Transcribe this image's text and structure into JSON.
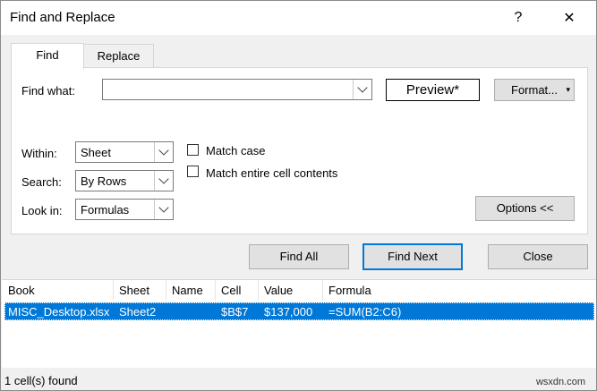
{
  "window": {
    "title": "Find and Replace",
    "help_glyph": "?",
    "close_glyph": "✕",
    "icons": [
      "help-icon",
      "close-icon"
    ]
  },
  "tabs": [
    {
      "label": "Find",
      "selected": true
    },
    {
      "label": "Replace",
      "selected": false
    }
  ],
  "find": {
    "label": "Find what:",
    "value": "",
    "preview": "Preview*",
    "format_label": "Format...",
    "format_arrow": "▾"
  },
  "options": {
    "within": {
      "label": "Within:",
      "value": "Sheet"
    },
    "search": {
      "label": "Search:",
      "value": "By Rows"
    },
    "look_in": {
      "label": "Look in:",
      "value": "Formulas"
    },
    "match_case": {
      "label": "Match case",
      "checked": false
    },
    "match_entire": {
      "label": "Match entire cell contents",
      "checked": false
    },
    "options_button": "Options <<"
  },
  "actions": {
    "find_all": "Find All",
    "find_next": "Find Next",
    "close": "Close"
  },
  "results": {
    "columns": [
      "Book",
      "Sheet",
      "Name",
      "Cell",
      "Value",
      "Formula"
    ],
    "rows": [
      {
        "book": "MISC_Desktop.xlsx",
        "sheet": "Sheet2",
        "name": "",
        "cell": "$B$7",
        "value": "$137,000",
        "formula": "=SUM(B2:C6)"
      }
    ],
    "status": "1 cell(s) found"
  },
  "watermark": "wsxdn.com",
  "colors": {
    "accent": "#0078d7",
    "selection": "#0078d7",
    "dialog_bg": "#f0f0f0"
  }
}
